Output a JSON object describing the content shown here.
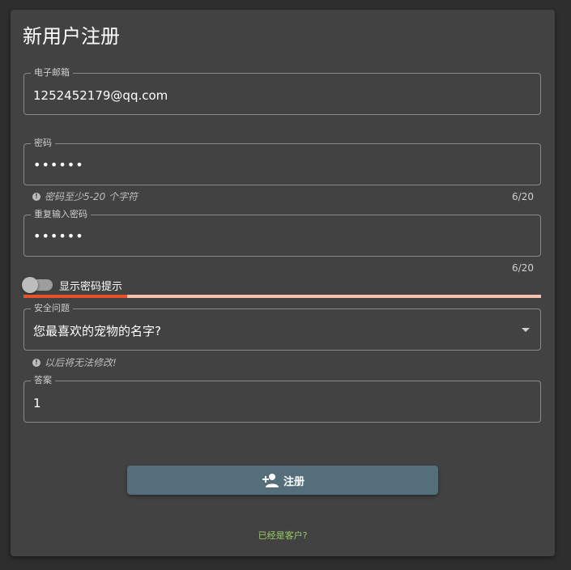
{
  "page": {
    "title": "新用户注册"
  },
  "email": {
    "label": "电子邮箱",
    "value": "1252452179@qq.com"
  },
  "password": {
    "label": "密码",
    "value": "••••••",
    "hint": "密码至少5-20 个字符",
    "counter": "6/20"
  },
  "confirm_password": {
    "label": "重复输入密码",
    "value": "••••••",
    "counter": "6/20"
  },
  "toggle": {
    "label": "显示密码提示",
    "on": false
  },
  "strength": {
    "fraction": 0.2,
    "fill_color": "#e6522c",
    "track_color": "#f5c2b1"
  },
  "security_question": {
    "label": "安全问题",
    "value": "您最喜欢的宠物的名字?",
    "hint": "以后将无法修改!"
  },
  "answer": {
    "label": "答案",
    "value": "1"
  },
  "submit": {
    "label": "注册",
    "icon": "person-add-icon",
    "color": "#546e7a"
  },
  "login_link": {
    "label": "已经是客户?",
    "color": "#9ccc65"
  }
}
